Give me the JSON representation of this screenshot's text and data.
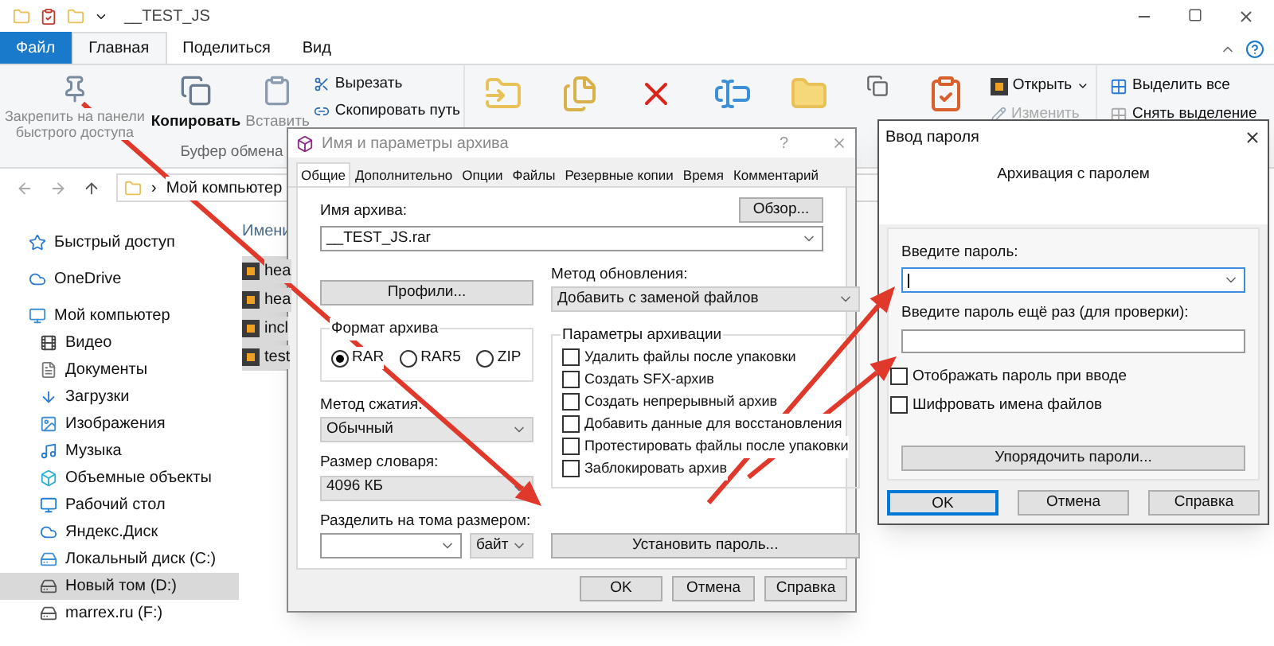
{
  "explorer": {
    "title": "__TEST_JS",
    "ribbon_tabs": [
      {
        "label": "Файл",
        "kind": "file",
        "selected": false
      },
      {
        "label": "Главная",
        "kind": "tab",
        "selected": true
      },
      {
        "label": "Поделиться",
        "kind": "tab",
        "selected": false
      },
      {
        "label": "Вид",
        "kind": "tab",
        "selected": false
      }
    ],
    "clipboard": {
      "pin": "Закрепить на панели быстрого доступа",
      "copy": "Копировать",
      "paste": "Вставить",
      "cut": "Вырезать",
      "copy_path": "Скопировать путь",
      "group": "Буфер обмена"
    },
    "open": {
      "open": "Открыть",
      "edit": "Изменить",
      "edit_disabled": true
    },
    "select": {
      "select_all": "Выделить все",
      "deselect": "Снять выделение"
    },
    "address_separator": "›",
    "address": "Мой компьютер",
    "nav": [
      {
        "label": "Быстрый доступ",
        "kind": "star",
        "selected": false
      },
      {
        "label": "OneDrive",
        "kind": "cloud",
        "selected": false
      },
      {
        "label": "Мой компьютер",
        "kind": "pc",
        "selected": false,
        "children": [
          {
            "label": "Видео",
            "kind": "video",
            "selected": false
          },
          {
            "label": "Документы",
            "kind": "docs",
            "selected": false
          },
          {
            "label": "Загрузки",
            "kind": "down",
            "selected": false
          },
          {
            "label": "Изображения",
            "kind": "image",
            "selected": false
          },
          {
            "label": "Музыка",
            "kind": "music",
            "selected": false
          },
          {
            "label": "Объемные объекты",
            "kind": "cube",
            "selected": false
          },
          {
            "label": "Рабочий стол",
            "kind": "desktop",
            "selected": false
          },
          {
            "label": "Яндекс.Диск",
            "kind": "cloud",
            "selected": false
          },
          {
            "label": "Локальный диск (C:)",
            "kind": "sysdrive",
            "selected": false
          },
          {
            "label": "Новый том (D:)",
            "kind": "drive",
            "selected": true
          },
          {
            "label": "marrex.ru (F:)",
            "kind": "drive",
            "selected": false
          }
        ]
      }
    ],
    "files": {
      "column": "Имени",
      "items": [
        {
          "name": "hea",
          "selected": true
        },
        {
          "name": "hea",
          "selected": true
        },
        {
          "name": "incl",
          "selected": true
        },
        {
          "name": "test",
          "selected": true
        }
      ]
    }
  },
  "archive": {
    "title": "Имя и параметры архива",
    "help": "?",
    "tabs": [
      {
        "label": "Общие",
        "selected": true
      },
      {
        "label": "Дополнительно",
        "selected": false
      },
      {
        "label": "Опции",
        "selected": false
      },
      {
        "label": "Файлы",
        "selected": false
      },
      {
        "label": "Резервные копии",
        "selected": false
      },
      {
        "label": "Время",
        "selected": false
      },
      {
        "label": "Комментарий",
        "selected": false
      }
    ],
    "name_label": "Имя архива:",
    "browse": "Обзор...",
    "name_value": "__TEST_JS.rar",
    "profiles": "Профили...",
    "update_label": "Метод обновления:",
    "update_value": "Добавить с заменой файлов",
    "format_label": "Формат архива",
    "formats": [
      {
        "label": "RAR",
        "selected": true
      },
      {
        "label": "RAR5",
        "selected": false
      },
      {
        "label": "ZIP",
        "selected": false
      }
    ],
    "options_label": "Параметры архивации",
    "options": [
      {
        "label": "Удалить файлы после упаковки",
        "checked": false
      },
      {
        "label": "Создать SFX-архив",
        "checked": false
      },
      {
        "label": "Создать непрерывный архив",
        "checked": false
      },
      {
        "label": "Добавить данные для восстановления",
        "checked": false
      },
      {
        "label": "Протестировать файлы после упаковки",
        "checked": false
      },
      {
        "label": "Заблокировать архив",
        "checked": false
      }
    ],
    "method_label": "Метод сжатия:",
    "method_value": "Обычный",
    "dict_label": "Размер словаря:",
    "dict_value": "4096 КБ",
    "split_label": "Разделить на тома размером:",
    "split_unit": "байт",
    "set_password": "Установить пароль...",
    "buttons": [
      "OK",
      "Отмена",
      "Справка"
    ]
  },
  "password": {
    "title": "Ввод пароля",
    "heading": "Архивация с паролем",
    "label1": "Введите пароль:",
    "label2": "Введите пароль ещё раз (для проверки):",
    "options": [
      {
        "label": "Отображать пароль при вводе",
        "checked": false
      },
      {
        "label": "Шифровать имена файлов",
        "checked": false
      }
    ],
    "organize": "Упорядочить пароли...",
    "buttons": [
      {
        "label": "OK",
        "selected": true
      },
      {
        "label": "Отмена",
        "selected": false
      },
      {
        "label": "Справка",
        "selected": false
      }
    ]
  }
}
